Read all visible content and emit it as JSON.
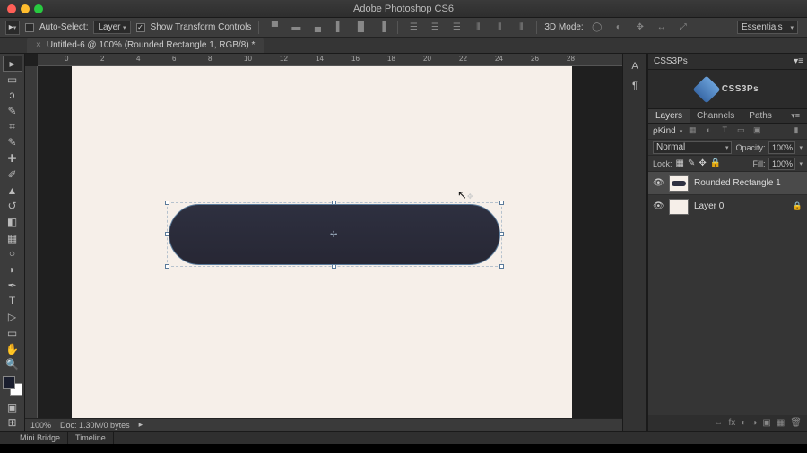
{
  "app": {
    "title": "Adobe Photoshop CS6"
  },
  "options": {
    "auto_select_label": "Auto-Select:",
    "auto_select_value": "Layer",
    "show_transform_label": "Show Transform Controls",
    "mode_label": "3D Mode:"
  },
  "workspace": {
    "label": "Essentials"
  },
  "tab": {
    "label": "Untitled-6 @ 100% (Rounded Rectangle 1, RGB/8) *"
  },
  "ruler_marks": [
    "0",
    "2",
    "4",
    "6",
    "8",
    "10",
    "12",
    "14",
    "16",
    "18",
    "20",
    "22",
    "24",
    "26",
    "28"
  ],
  "status": {
    "zoom": "100%",
    "doc": "Doc: 1.30M/0 bytes"
  },
  "bottom_tabs": [
    "Mini Bridge",
    "Timeline"
  ],
  "mini_icons": [
    "A",
    "¶"
  ],
  "css3ps": {
    "panel_title": "CSS3Ps",
    "brand": "CSS3Ps"
  },
  "layers_panel": {
    "tabs": [
      "Layers",
      "Channels",
      "Paths"
    ],
    "kind_label": "ρKind",
    "blend_mode": "Normal",
    "opacity_label": "Opacity:",
    "opacity_value": "100%",
    "lock_label": "Lock:",
    "fill_label": "Fill:",
    "fill_value": "100%",
    "layers": [
      {
        "name": "Rounded Rectangle 1",
        "selected": true,
        "visible": true,
        "thumb": "shape"
      },
      {
        "name": "Layer 0",
        "selected": false,
        "visible": true,
        "thumb": "blank",
        "locked": true
      }
    ]
  }
}
